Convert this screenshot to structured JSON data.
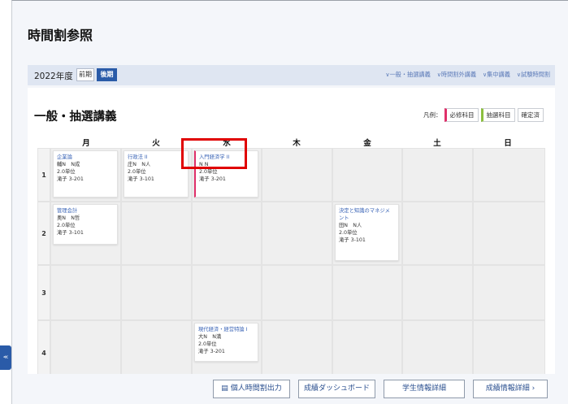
{
  "page": {
    "title": "時間割参照"
  },
  "term_bar": {
    "year": "2022年度",
    "terms": [
      {
        "label": "前期",
        "active": false
      },
      {
        "label": "後期",
        "active": true
      }
    ],
    "links": [
      "一般・抽選講義",
      "時間割外講義",
      "集中講義",
      "試験時間割"
    ]
  },
  "section": {
    "title": "一般・抽選講義",
    "legend": {
      "prefix": "凡例：",
      "required": "必修科目",
      "lottery": "抽選科目",
      "confirmed": "確定済"
    }
  },
  "timetable": {
    "days": [
      "月",
      "火",
      "水",
      "木",
      "金",
      "土",
      "日"
    ],
    "periods": [
      "1",
      "2",
      "3",
      "4"
    ],
    "courses": {
      "mon_1": {
        "name": "企業論",
        "teacher": "輔N　N成",
        "credits": "2.0単位",
        "room": "滝子 3-201"
      },
      "tue_1": {
        "name": "行政法 II",
        "teacher": "庄N　N人",
        "credits": "2.0単位",
        "room": "滝子 3-101"
      },
      "wed_1": {
        "name": "入門経済学 II",
        "teacher": "N N",
        "credits": "2.0単位",
        "room": "滝子 3-201"
      },
      "mon_2": {
        "name": "管理会計",
        "teacher": "奥N　N哲",
        "credits": "2.0単位",
        "room": "滝子 3-101"
      },
      "fri_2": {
        "name": "決定と知識のマネジメント",
        "teacher": "田N　N人",
        "credits": "2.0単位",
        "room": "滝子 3-101"
      },
      "wed_4": {
        "name": "現代経済・経営特論 I",
        "teacher": "大N　N満",
        "credits": "2.0単位",
        "room": "滝子 3-201"
      }
    }
  },
  "footer": {
    "print_label": "個人時間割出力",
    "dashboard_label": "成績ダッシュボード",
    "student_label": "学生情報詳細",
    "grades_label": "成績情報詳細"
  },
  "side_tab": {
    "label": "≪"
  },
  "colors": {
    "accent": "#2a5ba8",
    "required": "#e0306a",
    "lottery": "#8cbf3f",
    "highlight": "#e00000"
  }
}
